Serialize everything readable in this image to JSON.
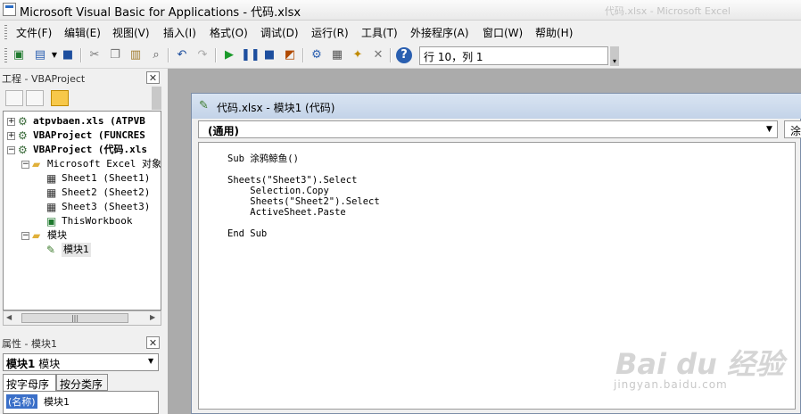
{
  "window": {
    "title": "Microsoft Visual Basic for Applications - 代码.xlsx",
    "background_title": "代码.xlsx - Microsoft Excel"
  },
  "menu": [
    "文件(F)",
    "编辑(E)",
    "视图(V)",
    "插入(I)",
    "格式(O)",
    "调试(D)",
    "运行(R)",
    "工具(T)",
    "外接程序(A)",
    "窗口(W)",
    "帮助(H)"
  ],
  "toolbar": {
    "position": "行 10，列 1"
  },
  "project_pane": {
    "title": "工程 - VBAProject",
    "close": "✕",
    "tree": [
      {
        "label": "atpvbaen.xls (ATPVB",
        "bold": true,
        "indent": 0,
        "expander": "+",
        "icon": "vba-project-icon"
      },
      {
        "label": "VBAProject (FUNCRES",
        "bold": true,
        "indent": 0,
        "expander": "+",
        "icon": "vba-project-icon"
      },
      {
        "label": "VBAProject (代码.xls",
        "bold": true,
        "indent": 0,
        "expander": "−",
        "icon": "vba-project-icon"
      },
      {
        "label": "Microsoft Excel 对象",
        "bold": false,
        "indent": 1,
        "expander": "−",
        "icon": "folder-icon"
      },
      {
        "label": "Sheet1 (Sheet1)",
        "bold": false,
        "indent": 2,
        "expander": "",
        "icon": "sheet-icon"
      },
      {
        "label": "Sheet2 (Sheet2)",
        "bold": false,
        "indent": 2,
        "expander": "",
        "icon": "sheet-icon"
      },
      {
        "label": "Sheet3 (Sheet3)",
        "bold": false,
        "indent": 2,
        "expander": "",
        "icon": "sheet-icon"
      },
      {
        "label": "ThisWorkbook",
        "bold": false,
        "indent": 2,
        "expander": "",
        "icon": "workbook-icon"
      },
      {
        "label": "模块",
        "bold": false,
        "indent": 1,
        "expander": "−",
        "icon": "folder-icon"
      },
      {
        "label": "模块1",
        "bold": false,
        "indent": 2,
        "expander": "",
        "icon": "module-icon",
        "selected": true
      }
    ]
  },
  "properties_pane": {
    "title": "属性 - 模块1",
    "close": "✕",
    "object_bold": "模块1",
    "object_type": "模块",
    "tabs": [
      "按字母序",
      "按分类序"
    ],
    "row_name": "(名称)",
    "row_value": "模块1"
  },
  "code_window": {
    "title": "代码.xlsx - 模块1 (代码)",
    "object_combo": "(通用)",
    "proc_combo": "涂鸦鲸鱼",
    "lines": [
      "Sub 涂鸦鲸鱼()",
      "",
      "Sheets(\"Sheet3\").Select",
      "    Selection.Copy",
      "    Sheets(\"Sheet2\").Select",
      "    ActiveSheet.Paste",
      "",
      "End Sub"
    ]
  },
  "watermark": {
    "logo": "Bai du 经验",
    "url": "jingyan.baidu.com"
  }
}
